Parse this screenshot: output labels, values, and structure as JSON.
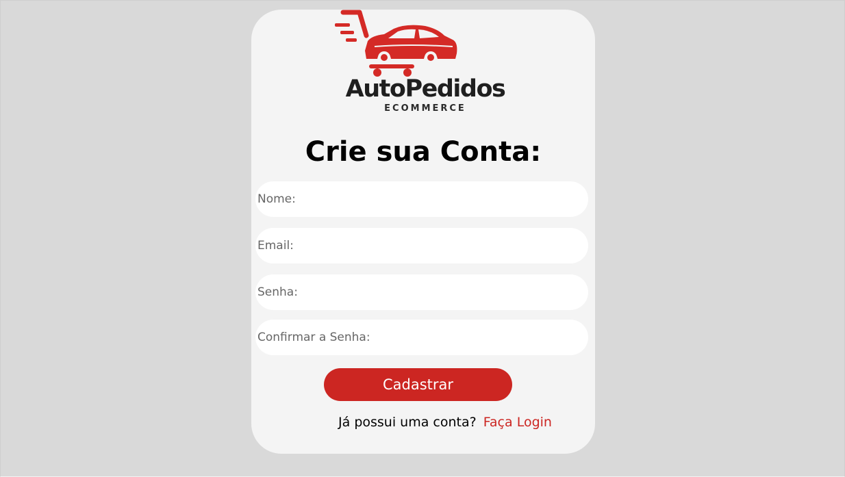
{
  "brand": {
    "name": "AutoPedidos",
    "tagline": "ECOMMERCE",
    "accent_color": "#cc2622",
    "logo_icon": "shopping-cart-car-icon"
  },
  "form": {
    "title": "Crie sua Conta:",
    "fields": [
      {
        "name": "nome",
        "placeholder": "Nome:",
        "value": ""
      },
      {
        "name": "email",
        "placeholder": "Email:",
        "value": ""
      },
      {
        "name": "senha",
        "placeholder": "Senha:",
        "value": ""
      },
      {
        "name": "confirmar-senha",
        "placeholder": "Confirmar a Senha:",
        "value": ""
      }
    ],
    "submit_label": "Cadastrar"
  },
  "footer": {
    "question": "Já possui uma conta?",
    "login_link": "Faça Login"
  }
}
